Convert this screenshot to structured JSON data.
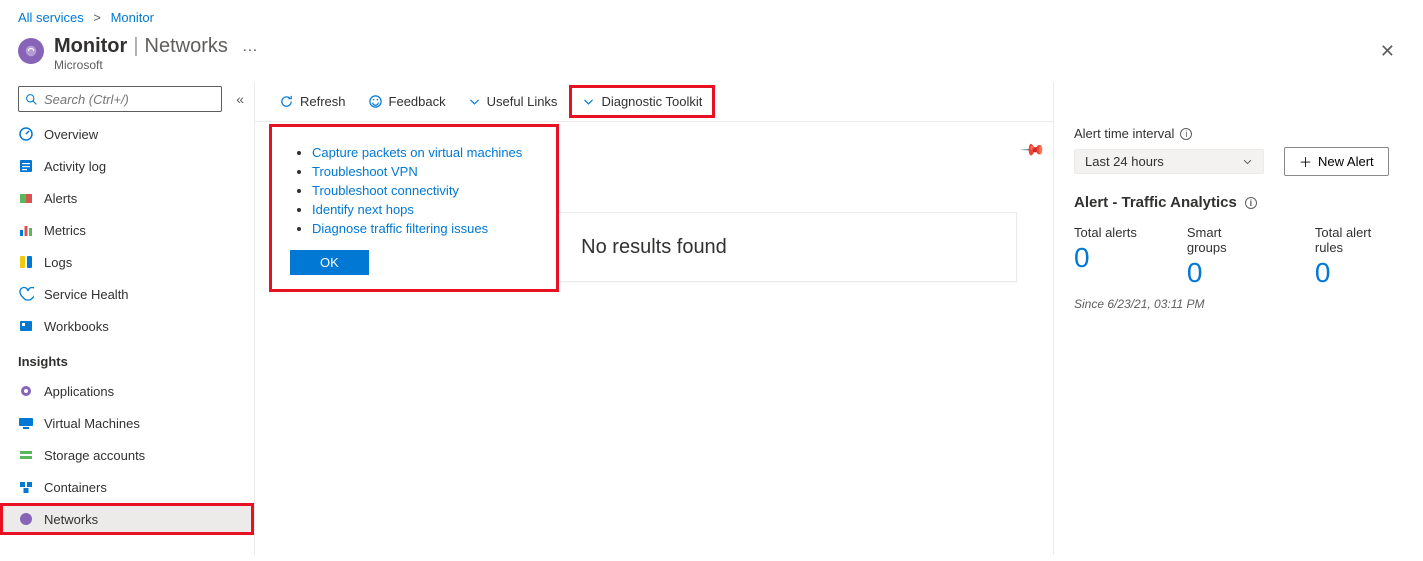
{
  "breadcrumb": {
    "root": "All services",
    "current": "Monitor"
  },
  "header": {
    "title": "Monitor",
    "section": "Networks",
    "subtitle": "Microsoft",
    "more": "…"
  },
  "search": {
    "placeholder": "Search (Ctrl+/)"
  },
  "sidebar": {
    "items": [
      {
        "label": "Overview"
      },
      {
        "label": "Activity log"
      },
      {
        "label": "Alerts"
      },
      {
        "label": "Metrics"
      },
      {
        "label": "Logs"
      },
      {
        "label": "Service Health"
      },
      {
        "label": "Workbooks"
      }
    ],
    "section": "Insights",
    "insights": [
      {
        "label": "Applications"
      },
      {
        "label": "Virtual Machines"
      },
      {
        "label": "Storage accounts"
      },
      {
        "label": "Containers"
      },
      {
        "label": "Networks"
      }
    ]
  },
  "toolbar": {
    "refresh": "Refresh",
    "feedback": "Feedback",
    "useful": "Useful Links",
    "diag": "Diagnostic Toolkit"
  },
  "popup": {
    "items": [
      "Capture packets on virtual machines",
      "Troubleshoot VPN",
      "Troubleshoot connectivity",
      "Identify next hops",
      "Diagnose traffic filtering issues"
    ],
    "ok": "OK"
  },
  "results": {
    "empty": "No results found"
  },
  "right": {
    "interval_label": "Alert time interval",
    "interval_value": "Last 24 hours",
    "new_alert": "New Alert",
    "section_title": "Alert - Traffic Analytics",
    "metrics": [
      {
        "label": "Total alerts",
        "value": "0"
      },
      {
        "label": "Smart groups",
        "value": "0"
      },
      {
        "label": "Total alert rules",
        "value": "0"
      }
    ],
    "since": "Since 6/23/21, 03:11 PM"
  }
}
